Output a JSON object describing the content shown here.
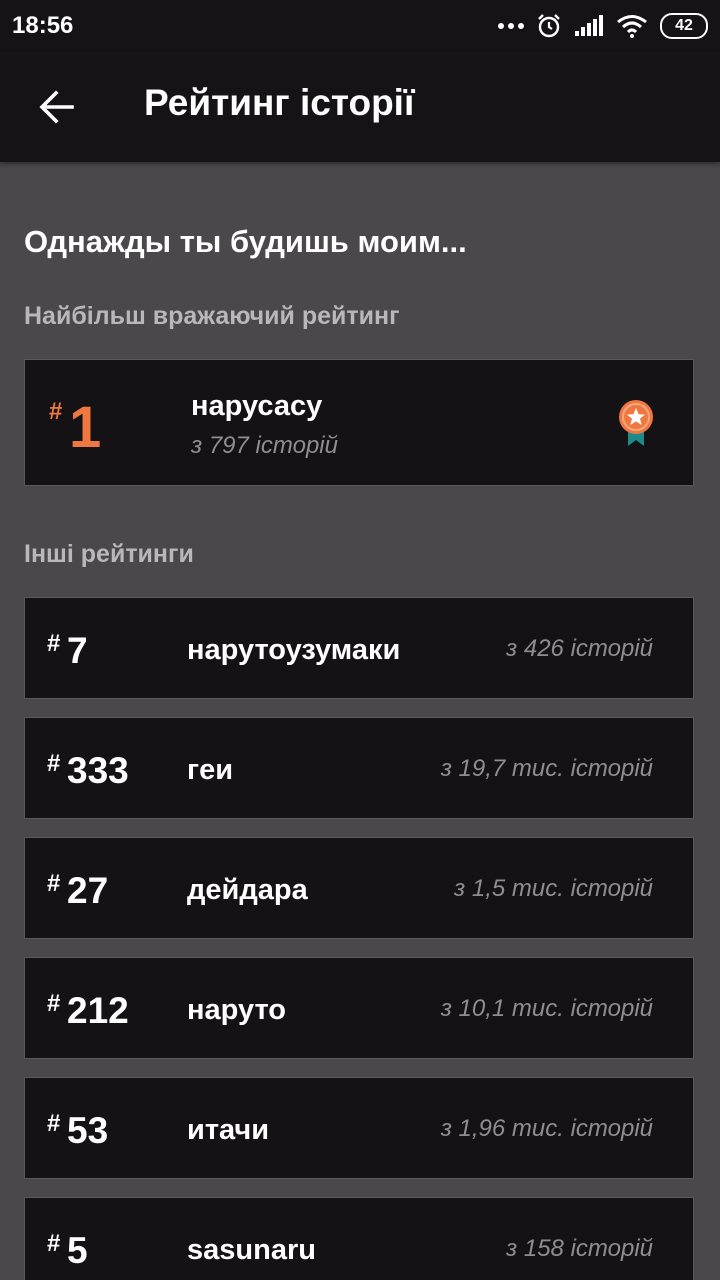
{
  "status_bar": {
    "time": "18:56",
    "battery": "42",
    "icons": [
      "more-dots-icon",
      "alarm-icon",
      "signal-icon",
      "wifi-icon",
      "battery-icon"
    ]
  },
  "app_bar": {
    "title": "Рейтинг історії",
    "back_icon": "arrow-back-icon"
  },
  "story_title": "Однажды ты будишь моим...",
  "featured_section": {
    "label": "Найбільш вражаючий рейтинг",
    "rank_prefix": "#",
    "rank": "1",
    "tag": "нарусасу",
    "count": "з 797 історій",
    "icon": "medal-icon",
    "accent": "#ef7841"
  },
  "other_section": {
    "label": "Інші рейтинги",
    "items": [
      {
        "prefix": "#",
        "rank": "7",
        "tag": "нарутоузумаки",
        "count": "з 426 історій"
      },
      {
        "prefix": "#",
        "rank": "333",
        "tag": "геи",
        "count": "з 19,7 тис. історій"
      },
      {
        "prefix": "#",
        "rank": "27",
        "tag": "дейдара",
        "count": "з 1,5 тис. історій"
      },
      {
        "prefix": "#",
        "rank": "212",
        "tag": "наруто",
        "count": "з 10,1 тис. історій"
      },
      {
        "prefix": "#",
        "rank": "53",
        "tag": "итачи",
        "count": "з 1,96 тис. історій"
      },
      {
        "prefix": "#",
        "rank": "5",
        "tag": "sasunaru",
        "count": "з 158 історій"
      }
    ]
  }
}
